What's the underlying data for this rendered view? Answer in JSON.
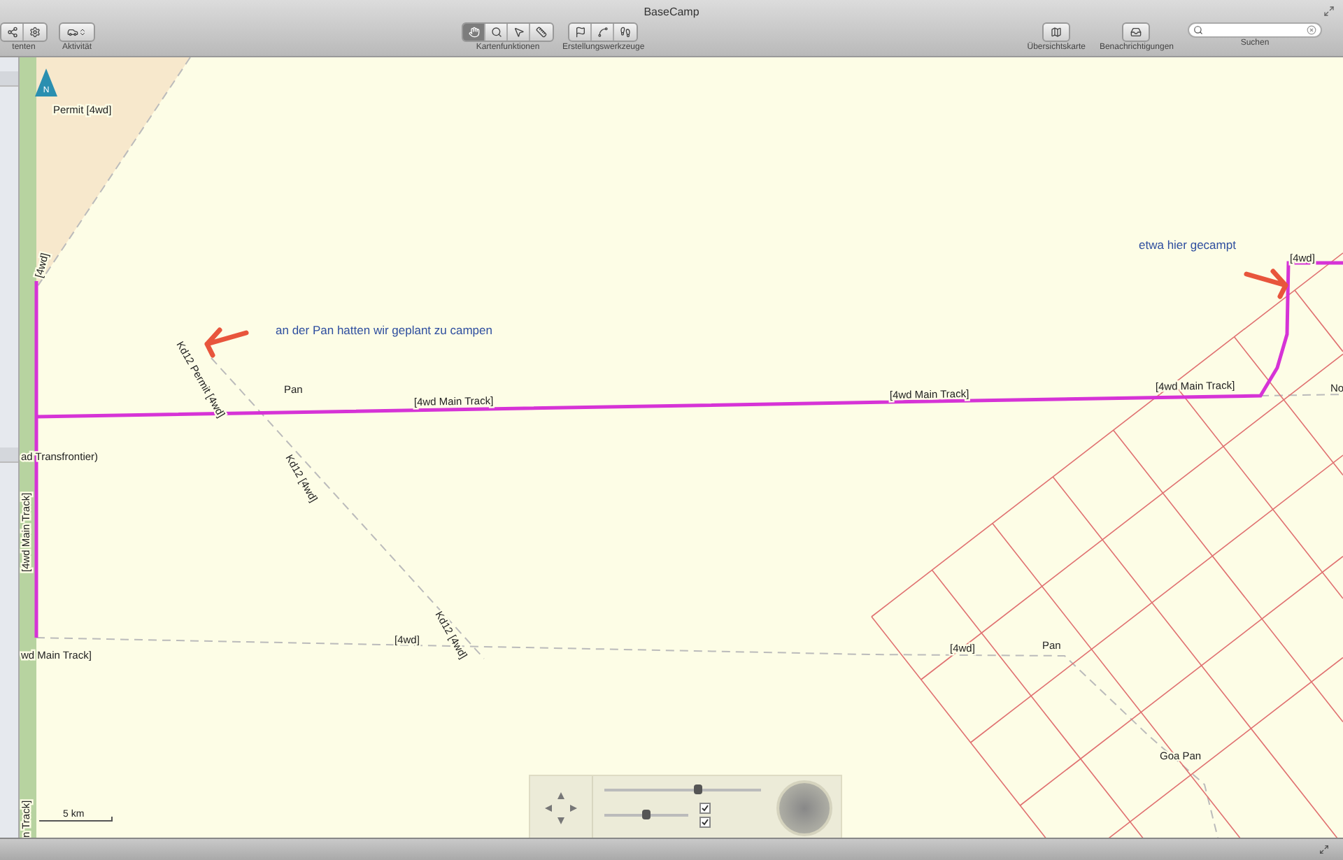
{
  "window": {
    "title": "BaseCamp"
  },
  "toolbar": {
    "left_groups": [
      {
        "label": "tenten"
      },
      {
        "label": "Aktivität"
      }
    ],
    "map_tools": {
      "label": "Kartenfunktionen",
      "tools": [
        {
          "kind": "hand",
          "selected": true
        },
        {
          "kind": "zoom",
          "selected": false
        },
        {
          "kind": "pointer",
          "selected": false
        },
        {
          "kind": "measure",
          "selected": false
        }
      ]
    },
    "create_tools": {
      "label": "Erstellungswerkzeuge"
    },
    "right_groups": [
      {
        "label": "Übersichtskarte"
      },
      {
        "label": "Benachrichtigungen"
      }
    ],
    "search": {
      "label": "Suchen"
    }
  },
  "map": {
    "labels": [
      {
        "text": "Permit [4wd]"
      },
      {
        "text": "[4wd]"
      },
      {
        "text": "Kd12 Permit [4wd]"
      },
      {
        "text": "Pan"
      },
      {
        "text": "[4wd Main Track]"
      },
      {
        "text": "[4wd Main Track]"
      },
      {
        "text": "[4wd Main Track]"
      },
      {
        "text": "No"
      },
      {
        "text": "[4wd]"
      },
      {
        "text": "ad Transfrontier)"
      },
      {
        "text": "Kd12 [4wd]"
      },
      {
        "text": "[4wd Main Track]"
      },
      {
        "text": "Kd12 [4wd]"
      },
      {
        "text": "[4wd]"
      },
      {
        "text": "[4wd]"
      },
      {
        "text": "Pan"
      },
      {
        "text": "Goa Pan"
      },
      {
        "text": "wd Main Track]"
      },
      {
        "text": "n Track]"
      }
    ],
    "annotations": [
      {
        "text": "an der Pan hatten wir geplant zu campen"
      },
      {
        "text": "etwa hier gecampt"
      }
    ],
    "north_arrow": {
      "label": "N"
    },
    "scale": "5 km",
    "controls": {
      "zoom_slider": {
        "level": 0.6
      },
      "detail_slider": {
        "level": 0.5
      },
      "checkboxes": [
        {
          "checked": true
        },
        {
          "checked": true
        }
      ]
    }
  }
}
